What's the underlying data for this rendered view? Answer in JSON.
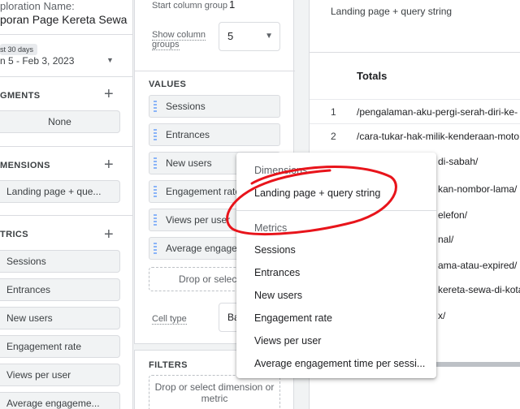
{
  "left_panel": {
    "exploration_label": "ploration Name:",
    "exploration_name": "poran Page Kereta Sewa",
    "date_badge": "st 30 days",
    "date_range": "n 5 - Feb 3, 2023",
    "segments": {
      "heading": "GMENTS",
      "items": [
        "None"
      ]
    },
    "dimensions": {
      "heading": "MENSIONS",
      "items": [
        "Landing page + que..."
      ]
    },
    "metrics": {
      "heading": "TRICS",
      "items": [
        "Sessions",
        "Entrances",
        "New users",
        "Engagement rate",
        "Views per user",
        "Average engageme..."
      ]
    }
  },
  "settings_panel": {
    "start_column_group_label": "Start column group",
    "start_column_group_value": "1",
    "show_column_groups_label_1": "Show column",
    "show_column_groups_label_2": "groups",
    "show_column_groups_value": "5",
    "values_heading": "VALUES",
    "values": [
      "Sessions",
      "Entrances",
      "New users",
      "Engagement rate",
      "Views per user",
      "Average engagement"
    ],
    "values_drop_text": "Drop or select m",
    "cell_type_label": "Cell type",
    "cell_type_value": "Ba",
    "filters_heading": "FILTERS",
    "filters_drop_text_1": "Drop or select dimension or",
    "filters_drop_text_2": "metric"
  },
  "table": {
    "header": "Landing page + query string",
    "totals_label": "Totals",
    "rows": [
      {
        "num": "1",
        "text": "/pengalaman-aku-pergi-serah-diri-ke-"
      },
      {
        "num": "2",
        "text": "/cara-tukar-hak-milik-kenderaan-moto"
      },
      {
        "num": "",
        "text": "di-sabah/"
      },
      {
        "num": "",
        "text": "kan-nombor-lama/"
      },
      {
        "num": "",
        "text": "elefon/"
      },
      {
        "num": "",
        "text": "nal/"
      },
      {
        "num": "",
        "text": "ama-atau-expired/"
      },
      {
        "num": "",
        "text": "kereta-sewa-di-kota"
      },
      {
        "num": "",
        "text": "x/"
      }
    ]
  },
  "menu": {
    "dimensions_heading": "Dimensions",
    "dimension_items": [
      "Landing page + query string"
    ],
    "metrics_heading": "Metrics",
    "metric_items": [
      "Sessions",
      "Entrances",
      "New users",
      "Engagement rate",
      "Views per user",
      "Average engagement time per sessi..."
    ]
  },
  "colors": {
    "annotation": "#e8141b",
    "chip_grip": "#8ab4f8"
  }
}
